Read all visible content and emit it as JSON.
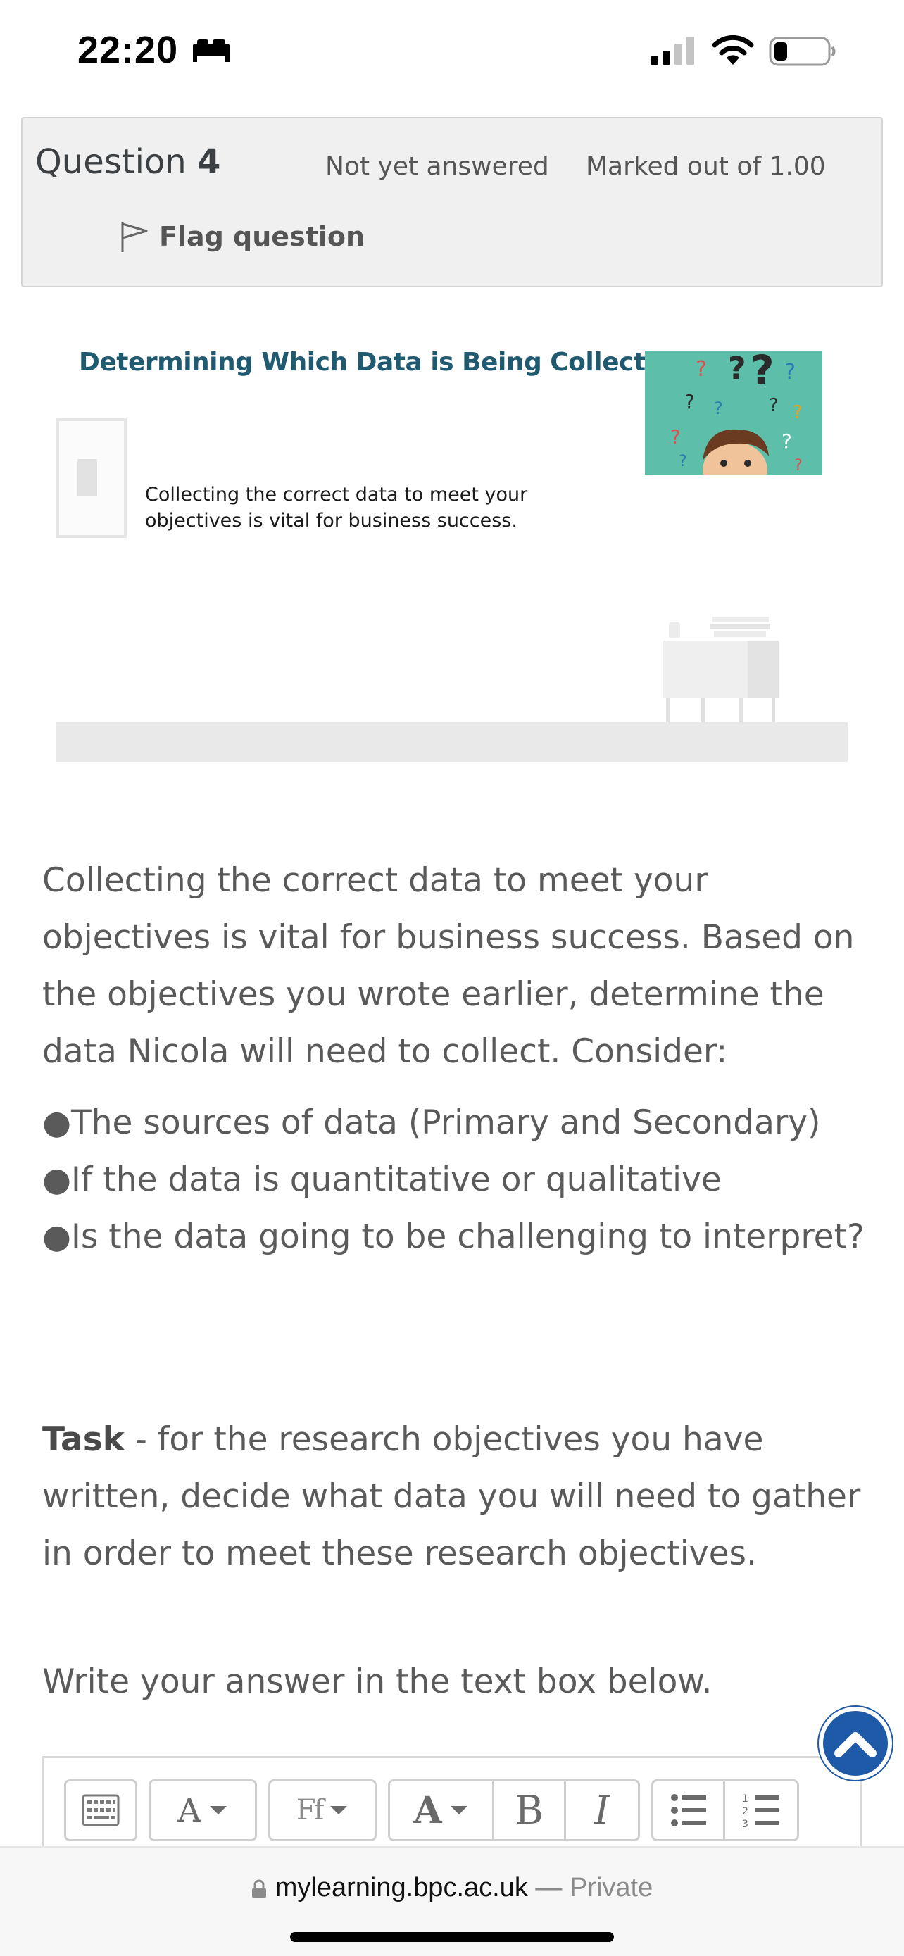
{
  "status_bar": {
    "time": "22:20"
  },
  "question": {
    "label": "Question",
    "number": "4",
    "state": "Not yet answered",
    "grade": "Marked out of 1.00",
    "flag_label": "Flag question"
  },
  "slide": {
    "title": "Determining Which Data is Being Collected",
    "subtitle_line1": "Collecting the correct data to meet your",
    "subtitle_line2": "objectives is vital for business success."
  },
  "content": {
    "intro": "Collecting the correct data to meet your objectives is vital for business success. Based on the objectives you wrote earlier, determine the data Nicola will need to collect. Consider:",
    "bullets": [
      "●The sources of data (Primary and Secondary)",
      "●If the data is quantitative or qualitative",
      "●Is the data going to be challenging to interpret?"
    ],
    "task_label": "Task",
    "task_text": " - for the research objectives you have written, decide what data you will need to gather in order to meet these research objectives.",
    "instruction": "Write your answer in the text box below."
  },
  "editor": {
    "font_color_label": "A",
    "font_family_label": "Ff",
    "font_size_label": "A",
    "bold_label": "B",
    "italic_label": "I"
  },
  "browser": {
    "domain": "mylearning.bpc.ac.uk",
    "separator": " — ",
    "mode": "Private"
  },
  "colors": {
    "accent": "#1e5aa8",
    "info_bg": "#f0f0f0",
    "slide_title": "#1f5a70",
    "photo_bg": "#5dbfa9"
  },
  "icons": [
    "bed-icon",
    "signal-icon",
    "wifi-icon",
    "battery-icon",
    "flag-icon",
    "chevron-up-icon",
    "lock-icon",
    "keyboard-icon",
    "bullet-list-icon",
    "numbered-list-icon"
  ]
}
